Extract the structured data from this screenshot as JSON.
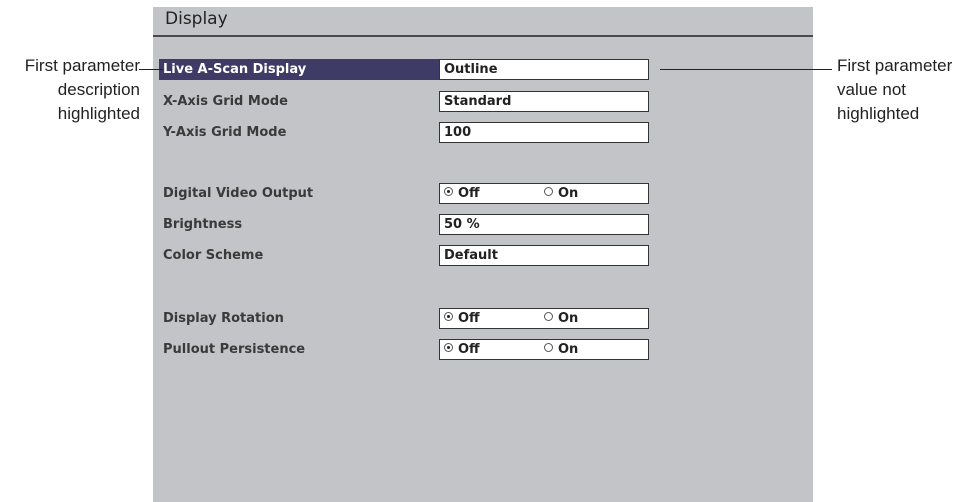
{
  "header": {
    "title": "Display"
  },
  "rows": [
    {
      "label": "Live A-Scan Display",
      "value": "Outline"
    },
    {
      "label": "X-Axis Grid Mode",
      "value": "Standard"
    },
    {
      "label": "Y-Axis Grid Mode",
      "value": "100"
    },
    {
      "label": "Digital Video Output",
      "off": "Off",
      "on": "On",
      "selected": "Off"
    },
    {
      "label": "Brightness",
      "value": "50 %"
    },
    {
      "label": "Color Scheme",
      "value": "Default"
    },
    {
      "label": "Display Rotation",
      "off": "Off",
      "on": "On",
      "selected": "Off"
    },
    {
      "label": "Pullout Persistence",
      "off": "Off",
      "on": "On",
      "selected": "Off"
    }
  ],
  "callouts": {
    "left": [
      "First parameter",
      "description",
      "highlighted"
    ],
    "right": [
      "First parameter",
      "value not",
      "highlighted"
    ]
  },
  "colors": {
    "screen_bg": "#c3c4c7",
    "highlight_bg": "#3e3b66"
  }
}
